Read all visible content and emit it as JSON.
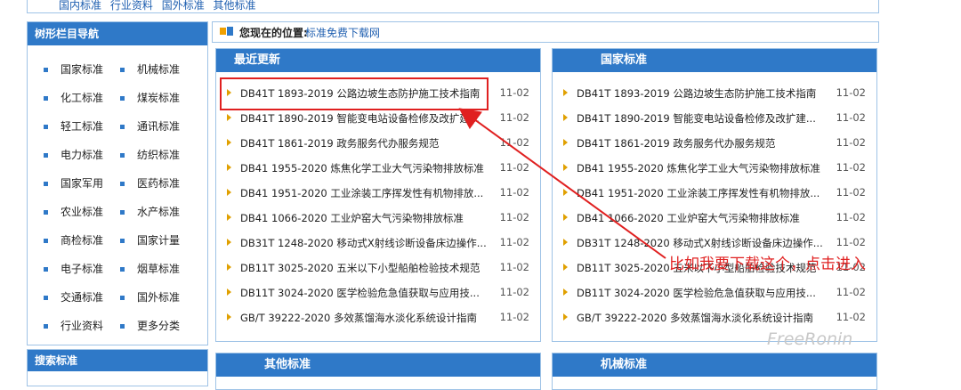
{
  "topnav": {
    "links": [
      "国内标准",
      "行业资料",
      "国外标准",
      "其他标准"
    ]
  },
  "sidebar": {
    "title": "树形栏目导航",
    "items": [
      "国家标准",
      "机械标准",
      "化工标准",
      "煤炭标准",
      "轻工标准",
      "通讯标准",
      "电力标准",
      "纺织标准",
      "国家军用",
      "医药标准",
      "农业标准",
      "水产标准",
      "商检标准",
      "国家计量",
      "电子标准",
      "烟草标准",
      "交通标准",
      "国外标准",
      "行业资料",
      "更多分类"
    ],
    "search_title": "搜索标准"
  },
  "location": {
    "label": "您现在的位置:",
    "value": "标准免费下载网"
  },
  "panels": {
    "recent": {
      "title": "最近更新",
      "rows": [
        {
          "text": "DB41T 1893-2019 公路边坡生态防护施工技术指南",
          "date": "11-02"
        },
        {
          "text": "DB41T 1890-2019 智能变电站设备检修及改扩建...",
          "date": "11-02"
        },
        {
          "text": "DB41T 1861-2019 政务服务代办服务规范",
          "date": "11-02"
        },
        {
          "text": "DB41 1955-2020 炼焦化学工业大气污染物排放标准",
          "date": "11-02"
        },
        {
          "text": "DB41 1951-2020 工业涂装工序挥发性有机物排放...",
          "date": "11-02"
        },
        {
          "text": "DB41 1066-2020 工业炉窑大气污染物排放标准",
          "date": "11-02"
        },
        {
          "text": "DB31T 1248-2020 移动式X射线诊断设备床边操作...",
          "date": "11-02"
        },
        {
          "text": "DB11T 3025-2020 五米以下小型船舶检验技术规范",
          "date": "11-02"
        },
        {
          "text": "DB11T 3024-2020 医学检验危急值获取与应用技...",
          "date": "11-02"
        },
        {
          "text": "GB/T 39222-2020 多效蒸馏海水淡化系统设计指南",
          "date": "11-02"
        }
      ]
    },
    "national": {
      "title": "国家标准",
      "rows": [
        {
          "text": "DB41T 1893-2019 公路边坡生态防护施工技术指南",
          "date": "11-02"
        },
        {
          "text": "DB41T 1890-2019 智能变电站设备检修及改扩建...",
          "date": "11-02"
        },
        {
          "text": "DB41T 1861-2019 政务服务代办服务规范",
          "date": "11-02"
        },
        {
          "text": "DB41 1955-2020 炼焦化学工业大气污染物排放标准",
          "date": "11-02"
        },
        {
          "text": "DB41 1951-2020 工业涂装工序挥发性有机物排放...",
          "date": "11-02"
        },
        {
          "text": "DB41 1066-2020 工业炉窑大气污染物排放标准",
          "date": "11-02"
        },
        {
          "text": "DB31T 1248-2020 移动式X射线诊断设备床边操作...",
          "date": "11-02"
        },
        {
          "text": "DB11T 3025-2020 五米以下小型船舶检验技术规范",
          "date": "11-02"
        },
        {
          "text": "DB11T 3024-2020 医学检验危急值获取与应用技...",
          "date": "11-02"
        },
        {
          "text": "GB/T 39222-2020 多效蒸馏海水淡化系统设计指南",
          "date": "11-02"
        }
      ]
    },
    "other": {
      "title": "其他标准"
    },
    "machinery": {
      "title": "机械标准"
    }
  },
  "annotation": {
    "text": "比如我要下载这个，点击进入",
    "color": "#e02020"
  },
  "watermark": "FreeRonin",
  "colors": {
    "header_blue": "#2f79c8",
    "link_blue": "#1f5fb0",
    "border": "#9fc3e6",
    "annotation_red": "#e02020"
  }
}
